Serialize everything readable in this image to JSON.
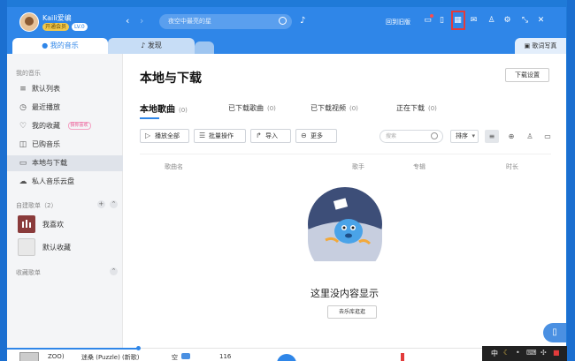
{
  "titlebar": {
    "username": "Kaili爱编",
    "badge_open": "开通会员",
    "badge_level": "LV.0",
    "search_placeholder": "夜空中最亮的星",
    "back_to_old": "回到旧版",
    "icons": [
      "back-icon",
      "forward-icon",
      "search-icon",
      "voice-icon",
      "monitor-icon",
      "phone-icon",
      "grid-icon",
      "mail-icon",
      "shirt-icon",
      "gear-icon",
      "minimize-icon",
      "close-icon"
    ]
  },
  "tabs": {
    "my_music": "我的音乐",
    "discover": "发现",
    "lyrics_poster": "歌词写真"
  },
  "sidebar": {
    "group_my_music": "我的音乐",
    "items": [
      {
        "label": "默认列表",
        "icon": "list-icon"
      },
      {
        "label": "最近播放",
        "icon": "clock-icon"
      },
      {
        "label": "我的收藏",
        "icon": "heart-icon",
        "tag": "猜你喜欢"
      },
      {
        "label": "已购音乐",
        "icon": "bag-icon"
      },
      {
        "label": "本地与下载",
        "icon": "monitor-icon"
      },
      {
        "label": "私人音乐云盘",
        "icon": "cloud-icon"
      }
    ],
    "created_group": "自建歌单",
    "created_count": "（2）",
    "playlists": [
      {
        "name": "我喜欢"
      },
      {
        "name": "默认收藏"
      }
    ],
    "collected_group": "收藏歌单"
  },
  "main": {
    "title": "本地与下载",
    "download_settings": "下载设置",
    "subtabs": [
      {
        "label": "本地歌曲",
        "count": "(0)"
      },
      {
        "label": "已下载歌曲",
        "count": "(0)"
      },
      {
        "label": "已下载视频",
        "count": "(0)"
      },
      {
        "label": "正在下载",
        "count": "(0)"
      }
    ],
    "toolbar": {
      "play_all": "播放全部",
      "batch": "批量操作",
      "import": "导入",
      "more": "更多",
      "search_placeholder": "搜索",
      "sort": "排序"
    },
    "columns": [
      "歌曲名",
      "歌手",
      "专辑",
      "时长"
    ],
    "empty_text": "这里没内容显示",
    "go_library": "去乐库逛逛"
  },
  "player": {
    "song": "ZOO)",
    "title": "迷桑 (Puzzle) (新歌)",
    "extra": "空",
    "time": "116"
  },
  "tray": {
    "ime": "中"
  },
  "colors": {
    "accent": "#2f86e8",
    "highlight": "#e23b3b"
  }
}
